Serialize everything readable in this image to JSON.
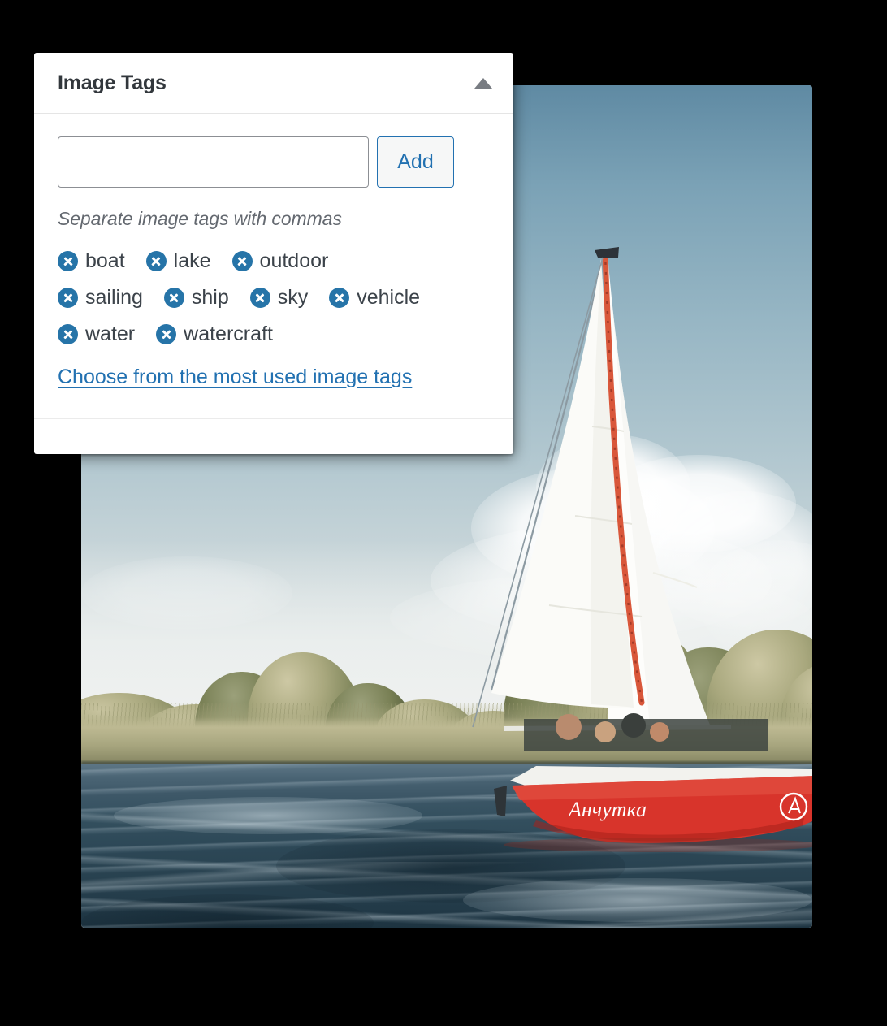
{
  "panel": {
    "title": "Image Tags",
    "toggle_icon": "caret-up-icon",
    "input": {
      "value": "",
      "placeholder": ""
    },
    "add_label": "Add",
    "helper_text": "Separate image tags with commas",
    "tags": [
      {
        "label": "boat",
        "remove_icon": "remove-circle-icon"
      },
      {
        "label": "lake",
        "remove_icon": "remove-circle-icon"
      },
      {
        "label": "outdoor",
        "remove_icon": "remove-circle-icon"
      },
      {
        "label": "sailing",
        "remove_icon": "remove-circle-icon"
      },
      {
        "label": "ship",
        "remove_icon": "remove-circle-icon"
      },
      {
        "label": "sky",
        "remove_icon": "remove-circle-icon"
      },
      {
        "label": "vehicle",
        "remove_icon": "remove-circle-icon"
      },
      {
        "label": "water",
        "remove_icon": "remove-circle-icon"
      },
      {
        "label": "watercraft",
        "remove_icon": "remove-circle-icon"
      }
    ],
    "choose_link": "Choose from the most used image tags",
    "colors": {
      "accent": "#2271b1",
      "tag_chip": "#2674a8",
      "title": "#32373c",
      "helper": "#646970",
      "panel_bg": "#ffffff"
    }
  },
  "photo": {
    "alt": "Red sailboat with white sails on a lake",
    "boat_name": "Анчутка",
    "colors": {
      "hull": "#d8342b",
      "sail": "#fbfbf8",
      "mast": "#d9573a",
      "sky_top": "#5f8aa3",
      "sky_horizon": "#eceeed",
      "water_top": "#5d7685",
      "water_bottom": "#1d3340",
      "foliage": "#7d8459"
    }
  },
  "background": {
    "color": "#000000"
  }
}
